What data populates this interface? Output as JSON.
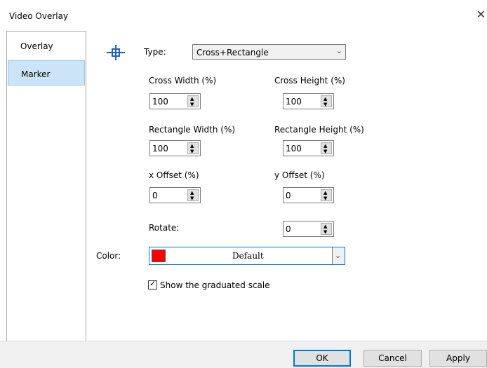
{
  "window": {
    "title": "Video Overlay",
    "close_glyph": "✕"
  },
  "nav": {
    "items": [
      {
        "label": "Overlay",
        "active": false
      },
      {
        "label": "Marker",
        "active": true
      }
    ]
  },
  "marker": {
    "icon": "crosshair-icon",
    "type_label": "Type:",
    "type_value": "Cross+Rectangle",
    "cross_width": {
      "label": "Cross Width (%)",
      "value": "100"
    },
    "cross_height": {
      "label": "Cross Height (%)",
      "value": "100"
    },
    "rect_width": {
      "label": "Rectangle Width (%)",
      "value": "100"
    },
    "rect_height": {
      "label": "Rectangle Height (%)",
      "value": "100"
    },
    "x_offset": {
      "label": "x Offset (%)",
      "value": "0"
    },
    "y_offset": {
      "label": "y Offset (%)",
      "value": "0"
    },
    "rotate": {
      "label": "Rotate:",
      "value": "0"
    },
    "color": {
      "label": "Color:",
      "value": "Default",
      "swatch": "#ff0000"
    },
    "show_scale": {
      "label": "Show the graduated scale",
      "checked": true
    }
  },
  "buttons": {
    "ok": "OK",
    "cancel": "Cancel",
    "apply": "Apply"
  },
  "colors": {
    "accent": "#0078d7",
    "nav_active_bg": "#cce4f7"
  }
}
